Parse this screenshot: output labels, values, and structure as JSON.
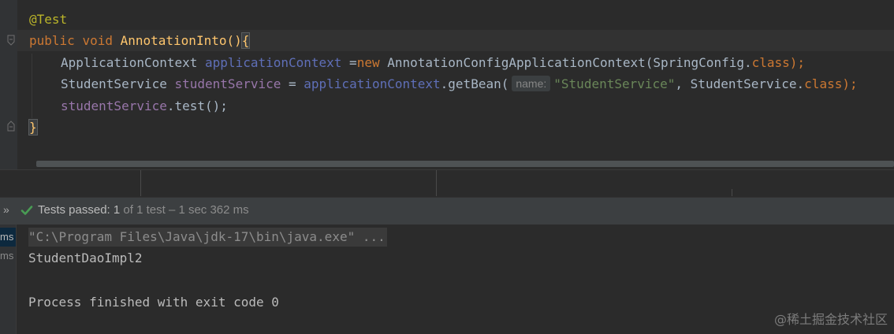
{
  "editor": {
    "annotation": "@Test",
    "kw_public": "public",
    "kw_void": "void",
    "method_name": "AnnotationInto",
    "paren_open_close": "()",
    "brace_open": "{",
    "line3": {
      "type": "ApplicationContext",
      "var": "applicationContext",
      "assign": " =",
      "kw_new": "new",
      "ctor": " AnnotationConfigApplicationContext(SpringConfig.",
      "kw_class": "class",
      "end": ");"
    },
    "line4": {
      "type": "StudentService",
      "var": "studentService",
      "assign": " = ",
      "ref": "applicationContext",
      "call": ".getBean(",
      "hint": "name:",
      "string": "\"StudentService\"",
      "arg2": ", StudentService.",
      "kw_class": "class",
      "end": ");"
    },
    "line5": {
      "var": "studentService",
      "call": ".test();"
    },
    "brace_close": "}"
  },
  "run_toolbar": {
    "chevron": "»",
    "status_label": "Tests passed:",
    "status_count": "1",
    "status_extra": "of 1 test – 1 sec 362 ms"
  },
  "console": {
    "tree_items": [
      "ms",
      "ms"
    ],
    "lines": [
      "\"C:\\Program Files\\Java\\jdk-17\\bin\\java.exe\" ...",
      "StudentDaoImpl2",
      "",
      "Process finished with exit code 0"
    ]
  },
  "watermark": "@稀土掘金技术社区",
  "colors": {
    "editor_bg": "#2b2b2b",
    "keyword": "#cc7832",
    "annotation": "#bbb529",
    "method": "#ffc66d",
    "field": "#9876aa",
    "string": "#6a8759",
    "pass_green": "#499c54"
  }
}
